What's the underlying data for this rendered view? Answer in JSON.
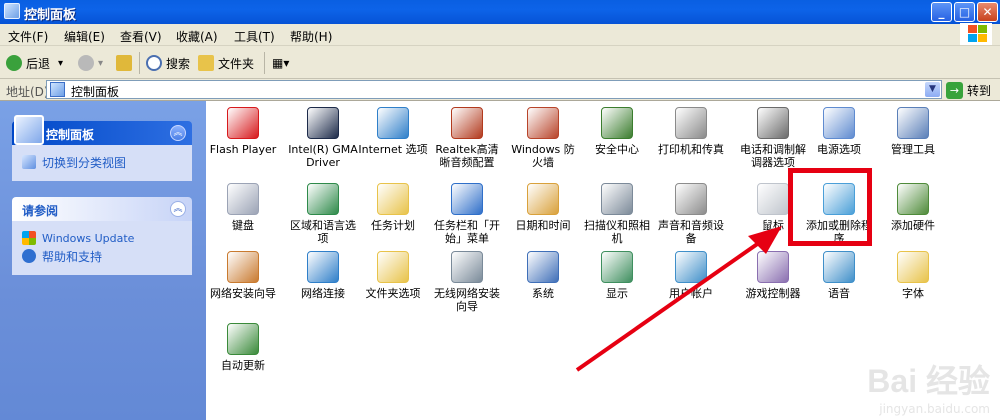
{
  "window": {
    "title": "控制面板",
    "minimize_glyph": "_",
    "maximize_glyph": "□",
    "close_glyph": "✕"
  },
  "menu": [
    "文件(F)",
    "编辑(E)",
    "查看(V)",
    "收藏(A)",
    "工具(T)",
    "帮助(H)"
  ],
  "toolbar": {
    "back_label": "后退",
    "search_label": "搜索",
    "folders_label": "文件夹",
    "dropdown_glyph": "▾",
    "views_glyph": "▦▾"
  },
  "address": {
    "label": "地址(D)",
    "value": "控制面板",
    "go_label": "转到",
    "go_glyph": "→",
    "dropdown_glyph": "▼"
  },
  "sidebar": {
    "control_panel": {
      "title": "控制面板",
      "link": "切换到分类视图",
      "collapse_glyph": "︽"
    },
    "see_also": {
      "title": "请参阅",
      "links": [
        "Windows Update",
        "帮助和支持"
      ],
      "collapse_glyph": "︽"
    }
  },
  "icons": [
    {
      "label": "Flash Player",
      "icon": "flash-icon",
      "color": "#d7191c"
    },
    {
      "label": "Intel(R) GMA Driver",
      "icon": "monitor-icon",
      "color": "#1d2b4a"
    },
    {
      "label": "Internet 选项",
      "icon": "globe-icon",
      "color": "#2f7fc9"
    },
    {
      "label": "Realtek高清晰音频配置",
      "icon": "speaker-icon",
      "color": "#b23a1e"
    },
    {
      "label": "Windows 防火墙",
      "icon": "firewall-icon",
      "color": "#b8442a"
    },
    {
      "label": "安全中心",
      "icon": "shield-icon",
      "color": "#3b7d2e"
    },
    {
      "label": "打印机和传真",
      "icon": "printer-icon",
      "color": "#8a8a8a"
    },
    {
      "label": "电话和调制解调器选项",
      "icon": "phone-icon",
      "color": "#6b6b6b"
    },
    {
      "label": "电源选项",
      "icon": "power-icon",
      "color": "#5f8bd0"
    },
    {
      "label": "管理工具",
      "icon": "tools-icon",
      "color": "#5a7fb8"
    },
    {
      "label": "键盘",
      "icon": "keyboard-icon",
      "color": "#9ba3b5"
    },
    {
      "label": "区域和语言选项",
      "icon": "globe-region-icon",
      "color": "#2e8a4a"
    },
    {
      "label": "任务计划",
      "icon": "task-folder-icon",
      "color": "#e8c34a"
    },
    {
      "label": "任务栏和「开始」菜单",
      "icon": "taskbar-icon",
      "color": "#2f6fc9"
    },
    {
      "label": "日期和时间",
      "icon": "clock-icon",
      "color": "#d9a13b"
    },
    {
      "label": "扫描仪和照相机",
      "icon": "scanner-icon",
      "color": "#7c8a99"
    },
    {
      "label": "声音和音频设备",
      "icon": "sound-icon",
      "color": "#8c8c8c"
    },
    {
      "label": "鼠标",
      "icon": "mouse-icon",
      "color": "#bfc4cc"
    },
    {
      "label": "添加或删除程序",
      "icon": "add-remove-programs-icon",
      "color": "#4a9fd8"
    },
    {
      "label": "添加硬件",
      "icon": "hardware-icon",
      "color": "#4f8b3a"
    },
    {
      "label": "网络安装向导",
      "icon": "home-network-icon",
      "color": "#c97a2f"
    },
    {
      "label": "网络连接",
      "icon": "network-globe-icon",
      "color": "#2f7fc9"
    },
    {
      "label": "文件夹选项",
      "icon": "folder-icon",
      "color": "#e8c34a"
    },
    {
      "label": "无线网络安装向导",
      "icon": "wireless-icon",
      "color": "#7a8a99"
    },
    {
      "label": "系统",
      "icon": "system-icon",
      "color": "#3f6fb8"
    },
    {
      "label": "显示",
      "icon": "display-icon",
      "color": "#3f8f5f"
    },
    {
      "label": "用户帐户",
      "icon": "users-icon",
      "color": "#3f8fc9"
    },
    {
      "label": "游戏控制器",
      "icon": "gamepad-icon",
      "color": "#8a6fb0"
    },
    {
      "label": "语音",
      "icon": "speech-icon",
      "color": "#3f8fc9"
    },
    {
      "label": "字体",
      "icon": "fonts-folder-icon",
      "color": "#e8c34a"
    },
    {
      "label": "自动更新",
      "icon": "windows-update-icon",
      "color": "#3a8a3a"
    }
  ],
  "colors": {
    "highlight": "#e60012",
    "link": "#215dc6"
  },
  "watermark": {
    "brand": "Bai 经验",
    "url": "jingyan.baidu.com"
  }
}
